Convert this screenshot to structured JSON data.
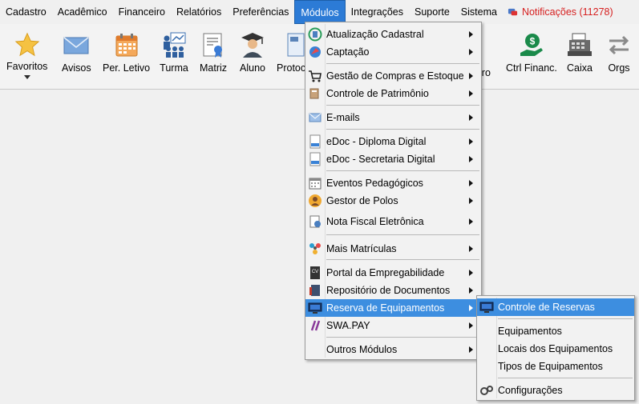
{
  "menubar": {
    "items": [
      "Cadastro",
      "Acadêmico",
      "Financeiro",
      "Relatórios",
      "Preferências",
      "Módulos",
      "Integrações",
      "Suporte",
      "Sistema"
    ],
    "notifications": "Notificações (11278)"
  },
  "toolbar": {
    "favoritos": "Favoritos",
    "avisos": "Avisos",
    "per_letivo": "Per. Letivo",
    "turma": "Turma",
    "matriz": "Matriz",
    "aluno": "Aluno",
    "protocolo_partial": "Protoc",
    "hidden_partial": "iro",
    "ctrl_financ": "Ctrl Financ.",
    "caixa": "Caixa",
    "orgs": "Orgs"
  },
  "modulos_menu": [
    "Atualização Cadastral",
    "Captação",
    "Gestão de Compras e Estoque",
    "Controle de Patrimônio",
    "E-mails",
    "eDoc - Diploma Digital",
    "eDoc - Secretaria Digital",
    "Eventos Pedagógicos",
    "Gestor de Polos",
    "Nota Fiscal Eletrônica",
    "Mais Matrículas",
    "Portal da Empregabilidade",
    "Repositório de Documentos",
    "Reserva de Equipamentos",
    "SWA.PAY",
    "Outros Módulos"
  ],
  "reserva_submenu": [
    "Controle de Reservas",
    "Equipamentos",
    "Locais dos Equipamentos",
    "Tipos de Equipamentos",
    "Configurações"
  ],
  "colors": {
    "menu_active": "#2c7bd6",
    "highlight": "#3d8ee0",
    "notification": "#d62020"
  }
}
